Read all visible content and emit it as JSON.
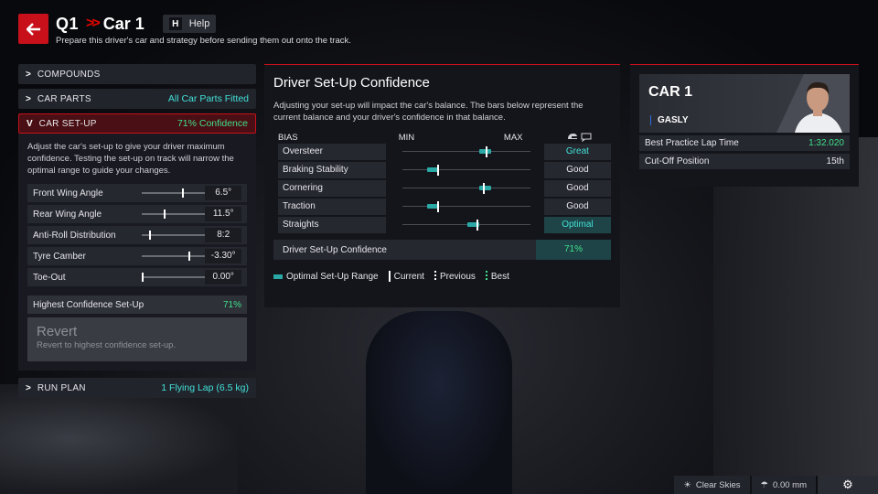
{
  "header": {
    "session": "Q1",
    "car": "Car 1",
    "help_key": "H",
    "help_label": "Help",
    "subtitle": "Prepare this driver's car and strategy before sending them out onto the track."
  },
  "left": {
    "compounds_label": "COMPOUNDS",
    "car_parts_label": "CAR PARTS",
    "car_parts_value": "All Car Parts Fitted",
    "car_setup_label": "CAR SET-UP",
    "car_setup_value": "71% Confidence",
    "setup_description": "Adjust the car's set-up to give your driver maximum confidence. Testing the set-up on track will narrow the optimal range to guide your changes.",
    "params": [
      {
        "name": "Front Wing Angle",
        "value": "6.5°",
        "level": 0.65
      },
      {
        "name": "Rear Wing Angle",
        "value": "11.5°",
        "level": 0.35
      },
      {
        "name": "Anti-Roll Distribution",
        "value": "8:2",
        "level": 0.12
      },
      {
        "name": "Tyre Camber",
        "value": "-3.30°",
        "level": 0.75
      },
      {
        "name": "Toe-Out",
        "value": "0.00°",
        "level": 0.0
      }
    ],
    "highest_label": "Highest Confidence Set-Up",
    "highest_value": "71%",
    "revert_title": "Revert",
    "revert_desc": "Revert to highest confidence set-up.",
    "run_plan_label": "RUN PLAN",
    "run_plan_value": "1 Flying Lap (6.5 kg)"
  },
  "center": {
    "title": "Driver Set-Up Confidence",
    "description": "Adjusting your set-up will impact the car's balance. The bars below represent the current balance and your driver's confidence in that balance.",
    "col_bias": "BIAS",
    "col_min": "MIN",
    "col_max": "MAX",
    "rows": [
      {
        "name": "Oversteer",
        "confidence": "Great",
        "style": "great",
        "range_start": 0.57,
        "range_end": 0.66,
        "current": 0.62
      },
      {
        "name": "Braking Stability",
        "confidence": "Good",
        "style": "",
        "range_start": 0.18,
        "range_end": 0.27,
        "current": 0.26
      },
      {
        "name": "Cornering",
        "confidence": "Good",
        "style": "",
        "range_start": 0.57,
        "range_end": 0.66,
        "current": 0.6
      },
      {
        "name": "Traction",
        "confidence": "Good",
        "style": "",
        "range_start": 0.18,
        "range_end": 0.27,
        "current": 0.26
      },
      {
        "name": "Straights",
        "confidence": "Optimal",
        "style": "opt",
        "range_start": 0.48,
        "range_end": 0.57,
        "current": 0.55
      }
    ],
    "confidence_label": "Driver Set-Up Confidence",
    "confidence_value": "71%",
    "legend": {
      "range": "Optimal Set-Up Range",
      "current": "Current",
      "previous": "Previous",
      "best": "Best"
    }
  },
  "car_card": {
    "car": "CAR 1",
    "driver": "GASLY",
    "best_lap_label": "Best Practice Lap Time",
    "best_lap_value": "1:32.020",
    "cutoff_label": "Cut-Off Position",
    "cutoff_value": "15th"
  },
  "status_bar": {
    "weather": "Clear Skies",
    "rain": "0.00 mm"
  },
  "colors": {
    "accent_red": "#c8101b",
    "teal": "#41e1d8",
    "green": "#3fe08a"
  }
}
